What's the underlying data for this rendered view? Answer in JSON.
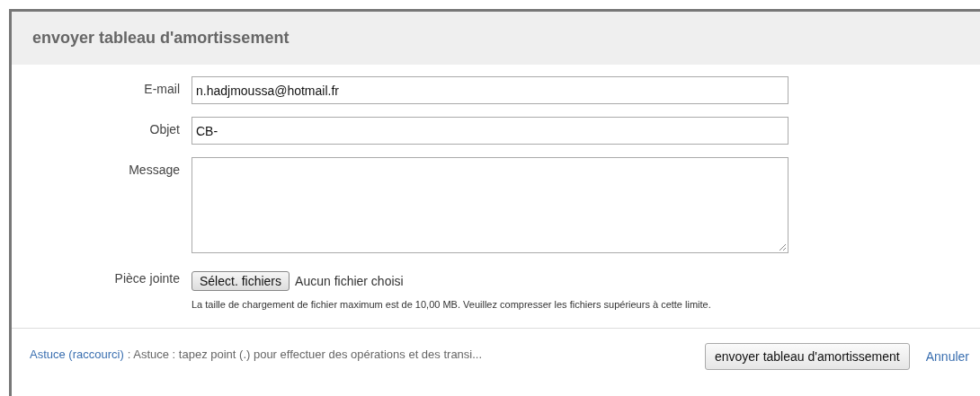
{
  "dialog": {
    "title": "envoyer tableau d'amortissement"
  },
  "fields": [
    {
      "kind": "input",
      "label": "E-mail",
      "value": "n.hadjmoussa@hotmail.fr"
    },
    {
      "kind": "input",
      "label": "Objet",
      "value": "CB-"
    },
    {
      "kind": "textarea",
      "label": "Message"
    }
  ],
  "attachment": {
    "label": "Pièce jointe",
    "button": "Sélect. fichiers",
    "status": "Aucun fichier choisi",
    "hint": "La taille de chargement de fichier maximum est de 10,00 MB. Veuillez compresser les fichiers supérieurs à cette limite."
  },
  "footer": {
    "tip_link": "Astuce (raccourci)",
    "tip_text": ": Astuce : tapez point (.) pour effectuer des opérations et des transi...",
    "submit": "envoyer tableau d'amortissement",
    "cancel": "Annuler"
  }
}
